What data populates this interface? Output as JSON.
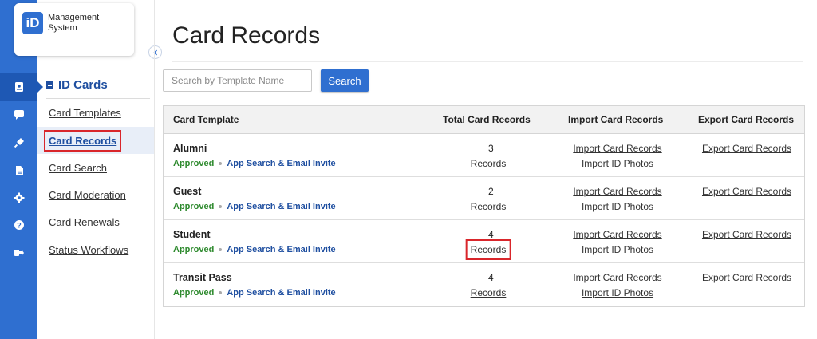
{
  "app": {
    "logo_mark": "iD",
    "logo_text_line1": "Management",
    "logo_text_line2": "System"
  },
  "rail": {
    "icons": [
      "id-card-icon",
      "chat-icon",
      "plug-icon",
      "document-icon",
      "gear-icon",
      "help-icon",
      "logout-icon"
    ],
    "active_index": 0,
    "color": "#2f6fd0"
  },
  "subnav": {
    "title": "ID Cards",
    "items": [
      {
        "label": "Card Templates"
      },
      {
        "label": "Card Records"
      },
      {
        "label": "Card Search"
      },
      {
        "label": "Card Moderation"
      },
      {
        "label": "Card Renewals"
      },
      {
        "label": "Status Workflows"
      }
    ],
    "active": "Card Records"
  },
  "page": {
    "title": "Card Records"
  },
  "search": {
    "placeholder": "Search by Template Name",
    "value": "",
    "button_label": "Search"
  },
  "table": {
    "headers": [
      "Card Template",
      "Total Card Records",
      "Import Card Records",
      "Export Card Records"
    ],
    "rows": [
      {
        "name": "Alumni",
        "status": "Approved",
        "access": "App Search & Email Invite",
        "count": "3",
        "records_label": "Records",
        "import_records": "Import Card Records",
        "import_photos": "Import ID Photos",
        "export_records": "Export Card Records"
      },
      {
        "name": "Guest",
        "status": "Approved",
        "access": "App Search & Email Invite",
        "count": "2",
        "records_label": "Records",
        "import_records": "Import Card Records",
        "import_photos": "Import ID Photos",
        "export_records": "Export Card Records"
      },
      {
        "name": "Student",
        "status": "Approved",
        "access": "App Search & Email Invite",
        "count": "4",
        "records_label": "Records",
        "import_records": "Import Card Records",
        "import_photos": "Import ID Photos",
        "export_records": "Export Card Records"
      },
      {
        "name": "Transit Pass",
        "status": "Approved",
        "access": "App Search & Email Invite",
        "count": "4",
        "records_label": "Records",
        "import_records": "Import Card Records",
        "import_photos": "Import ID Photos",
        "export_records": "Export Card Records"
      }
    ]
  },
  "colors": {
    "accent": "#2f6fd0",
    "highlight": "#d9262b",
    "approved": "#2e8a2e",
    "link_blue": "#1f4fa0"
  }
}
